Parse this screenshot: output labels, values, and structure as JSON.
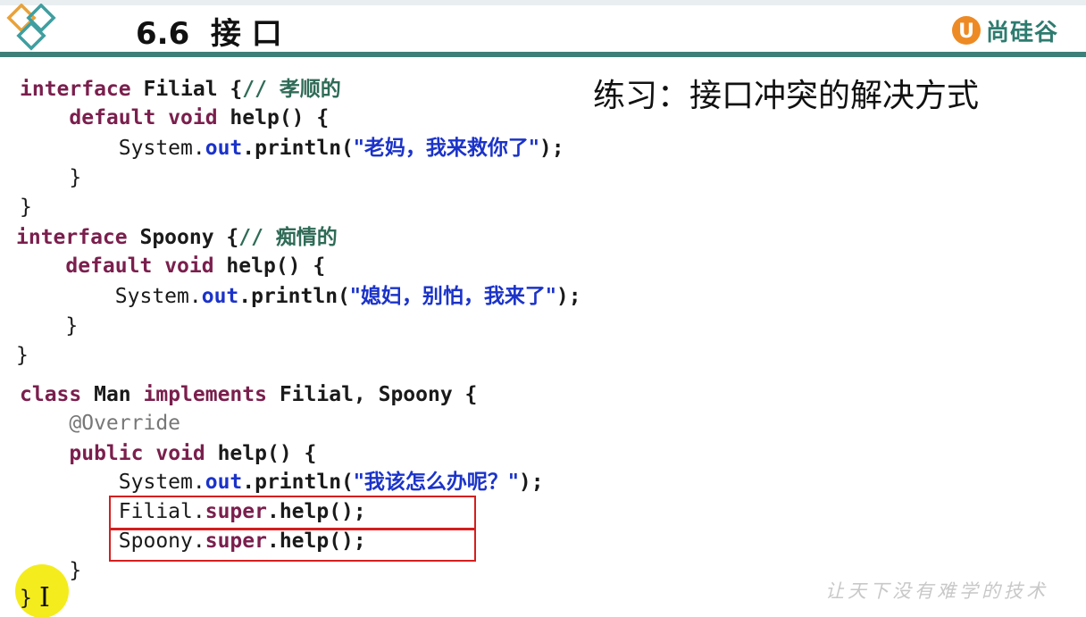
{
  "header": {
    "title": "6.6  接 口",
    "brand": "尚硅谷",
    "brand_mark": "U"
  },
  "exercise_title": "练习：接口冲突的解决方式",
  "code": {
    "l1": {
      "kw": "interface",
      "name": " Filial ",
      "brace": "{",
      "comment": "// 孝顺的"
    },
    "l2": {
      "indent": "    ",
      "kw1": "default",
      "kw2": "void",
      "rest": " help() {"
    },
    "l3": {
      "indent": "        ",
      "cls": "System.",
      "field": "out",
      "call": ".println(",
      "str": "\"老妈，我来救你了\"",
      "end": ");"
    },
    "l4": {
      "text": "    }"
    },
    "l5": {
      "text": "}"
    },
    "l6": {
      "kw": "interface",
      "name": " Spoony ",
      "brace": "{",
      "comment": "// 痴情的"
    },
    "l7": {
      "indent": "    ",
      "kw1": "default",
      "kw2": "void",
      "rest": " help() {"
    },
    "l8": {
      "indent": "        ",
      "cls": "System.",
      "field": "out",
      "call": ".println(",
      "str": "\"媳妇，别怕，我来了\"",
      "end": ");"
    },
    "l9": {
      "text": "    }"
    },
    "l10": {
      "text": "}"
    },
    "l11": {
      "kw1": "class",
      "name": " Man ",
      "kw2": "implements",
      "rest": " Filial, Spoony {"
    },
    "l12": {
      "indent": "    ",
      "ann": "@Override"
    },
    "l13": {
      "indent": "    ",
      "kw1": "public",
      "kw2": "void",
      "rest": " help() {"
    },
    "l14": {
      "indent": "        ",
      "cls": "System.",
      "field": "out",
      "call": ".println(",
      "str": "\"我该怎么办呢？\"",
      "end": ");"
    },
    "l15": {
      "indent": "        ",
      "cls": "Filial.",
      "kw": "super",
      "rest": ".help();"
    },
    "l16": {
      "indent": "        ",
      "cls": "Spoony.",
      "kw": "super",
      "rest": ".help();"
    },
    "l17": {
      "text": "    }"
    },
    "l18": {
      "text": "}"
    }
  },
  "watermark": "让天下没有难学的技术",
  "colors": {
    "header_rule": "#3f7f7a",
    "keyword": "#7a1f4d",
    "string": "#1b33c9",
    "comment": "#2f6b57",
    "highlight_box": "#d61e1e",
    "cursor_highlight": "#f4ec1c",
    "brand": "#2e7b6f"
  },
  "icons": {
    "logo": "diamond-logo-icon",
    "brand": "atguigu-logo-icon",
    "cursor": "text-cursor-icon"
  }
}
